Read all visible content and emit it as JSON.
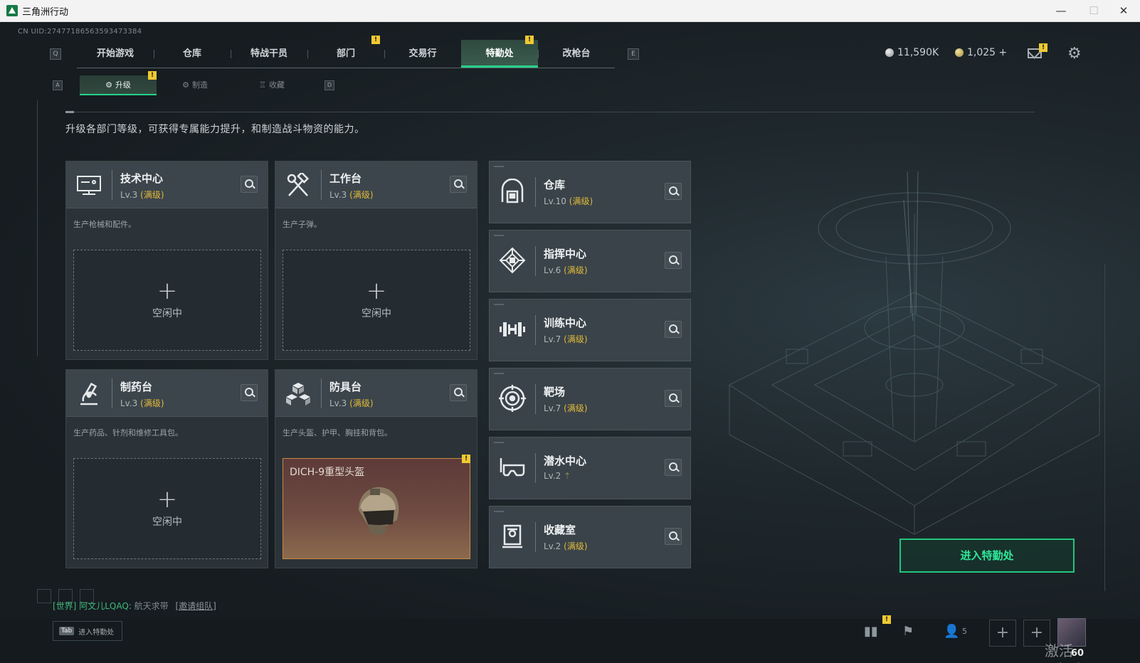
{
  "window": {
    "title": "三角洲行动",
    "min": "—",
    "max": "☐",
    "close": "✕"
  },
  "uid": "CN UID:2747718656359347338​4",
  "topnav": {
    "key_left": "Q",
    "key_right": "E",
    "tabs": [
      {
        "label": "开始游戏",
        "active": false,
        "warn": false
      },
      {
        "label": "仓库",
        "active": false,
        "warn": false
      },
      {
        "label": "特战干员",
        "active": false,
        "warn": false
      },
      {
        "label": "部门",
        "active": false,
        "warn": true
      },
      {
        "label": "交易行",
        "active": false,
        "warn": false
      },
      {
        "label": "特勤处",
        "active": true,
        "warn": true
      },
      {
        "label": "改枪台",
        "active": false,
        "warn": false
      }
    ],
    "currency_silver": "11,590K",
    "currency_gold": "1,025 +"
  },
  "subnav": {
    "key_left": "A",
    "key_right": "D",
    "tabs": [
      {
        "label": "升级",
        "active": true,
        "warn": true
      },
      {
        "label": "制造",
        "active": false
      },
      {
        "label": "收藏",
        "active": false
      }
    ]
  },
  "description": "升级各部门等级，可获得专属能力提升，和制造战斗物资的能力。",
  "production_cards": [
    {
      "name": "技术中心",
      "level": "Lv.3",
      "max": "(满级)",
      "sub": "生产枪械和配件。",
      "slot_plus": "+",
      "slot_status": "空闲中",
      "icon": "monitor-icon"
    },
    {
      "name": "工作台",
      "level": "Lv.3",
      "max": "(满级)",
      "sub": "生产子弹。",
      "slot_plus": "+",
      "slot_status": "空闲中",
      "icon": "hammer-wrench-icon"
    },
    {
      "name": "制药台",
      "level": "Lv.3",
      "max": "(满级)",
      "sub": "生产药品、针剂和维修工具包。",
      "slot_plus": "+",
      "slot_status": "空闲中",
      "icon": "microscope-icon"
    },
    {
      "name": "防具台",
      "level": "Lv.3",
      "max": "(满级)",
      "sub": "生产头盔、护甲、胸挂和背包。",
      "slot_item": "DICH-9重型头盔",
      "icon": "cubes-icon"
    }
  ],
  "department_cards": [
    {
      "name": "仓库",
      "level": "Lv.10",
      "max": "(满级)",
      "icon": "vault-icon"
    },
    {
      "name": "指挥中心",
      "level": "Lv.6",
      "max": "(满级)",
      "icon": "command-icon"
    },
    {
      "name": "训练中心",
      "level": "Lv.7",
      "max": "(满级)",
      "icon": "dumbbell-icon"
    },
    {
      "name": "靶场",
      "level": "Lv.7",
      "max": "(满级)",
      "icon": "target-icon"
    },
    {
      "name": "潜水中心",
      "level": "Lv.2",
      "max": "",
      "icon": "diving-mask-icon"
    },
    {
      "name": "收藏室",
      "level": "Lv.2",
      "max": "(满级)",
      "icon": "collection-icon"
    }
  ],
  "enter_button": "进入特勤处",
  "chat": {
    "channel": "[世界]",
    "user": "阿文儿LQAQ:",
    "message": "航天求带",
    "invite": "[邀请组队]"
  },
  "bottom": {
    "tab_key": "Tab",
    "tab_label": "进入特勤处",
    "friends_count": "5",
    "level": "60"
  },
  "watermark": "激活 Windows",
  "colors": {
    "accent": "#26d28a",
    "warn": "#f0c930",
    "max_level": "#e2b93a"
  }
}
